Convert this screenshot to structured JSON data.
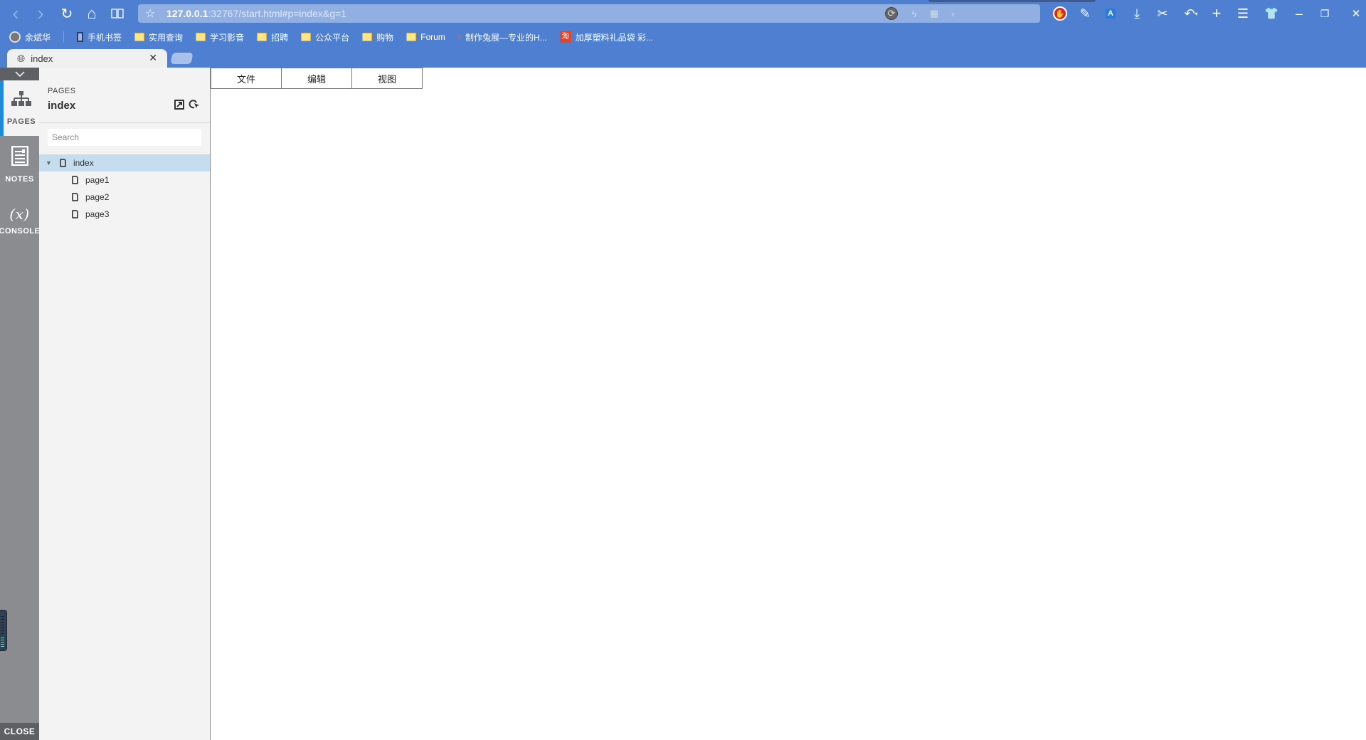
{
  "browser": {
    "nav": {
      "back_icon": "‹",
      "forward_icon": "›",
      "reload_icon": "↻",
      "home_icon": "⌂",
      "reader_icon": "▯▯"
    },
    "address": {
      "host": "127.0.0.1",
      "rest": ":32767/start.html#p=index&g=1"
    },
    "bookmarks": [
      {
        "label": "余斌华",
        "icon": "avatar"
      },
      {
        "label": "手机书签",
        "icon": "phone"
      },
      {
        "label": "实用查询",
        "icon": "folder"
      },
      {
        "label": "学习影音",
        "icon": "folder"
      },
      {
        "label": "招聘",
        "icon": "folder"
      },
      {
        "label": "公众平台",
        "icon": "folder"
      },
      {
        "label": "购物",
        "icon": "folder"
      },
      {
        "label": "Forum",
        "icon": "folder"
      },
      {
        "label": "制作兔展—专业的H...",
        "icon": "rabbit"
      },
      {
        "label": "加厚塑料礼品袋 彩...",
        "icon": "taobao"
      }
    ],
    "tab": {
      "title": "index",
      "close_glyph": "✕"
    },
    "window_controls": {
      "minimize": "–",
      "restore": "❐",
      "close": "✕"
    }
  },
  "rail": {
    "collapse_glyph": "⌄",
    "items": [
      {
        "label": "PAGES",
        "icon": "sitemap-icon",
        "glyph": "品",
        "active": true
      },
      {
        "label": "NOTES",
        "icon": "notes-icon",
        "glyph": "☰",
        "active": false
      },
      {
        "label": "CONSOLE",
        "icon": "variable-icon",
        "glyph": "(x)",
        "active": false
      }
    ],
    "close_label": "CLOSE"
  },
  "panel": {
    "section_label": "PAGES",
    "current_page": "index",
    "search_placeholder": "Search",
    "search_value": "",
    "tree": [
      {
        "label": "index",
        "level": 0,
        "expanded": true,
        "selected": true
      },
      {
        "label": "page1",
        "level": 1,
        "selected": false
      },
      {
        "label": "page2",
        "level": 1,
        "selected": false
      },
      {
        "label": "page3",
        "level": 1,
        "selected": false
      }
    ]
  },
  "menubar": {
    "items": [
      "文件",
      "编辑",
      "视图"
    ]
  },
  "colors": {
    "chrome_blue": "#4f7fd1",
    "selected_row": "#c5ddee",
    "rail_accent": "#1e8bd8"
  }
}
